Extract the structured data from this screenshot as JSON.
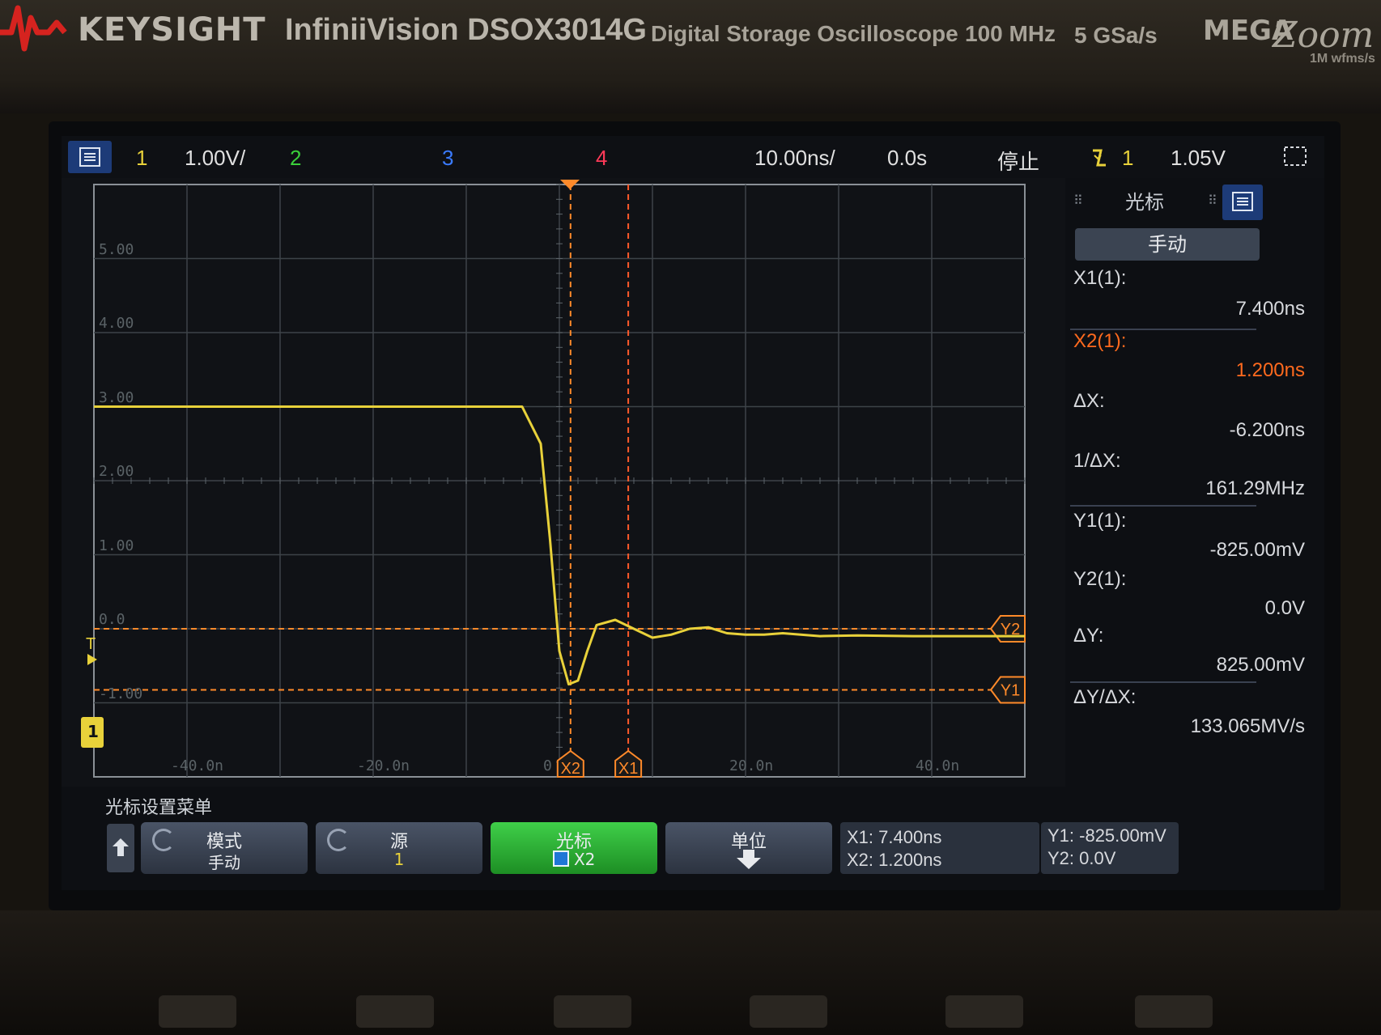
{
  "header": {
    "brand": "KEYSIGHT",
    "model": "InfiniiVision DSOX3014G",
    "description": "Digital Storage Oscilloscope",
    "bandwidth": "100 MHz",
    "sample_rate": "5 GSa/s",
    "badge_mega": "MEGA",
    "badge_zoom": "Zoom",
    "badge_wfms": "1M wfms/s"
  },
  "status_bar": {
    "menu_icon": "menu-icon",
    "ch1_label": "1",
    "ch1_scale": "1.00V/",
    "ch2_label": "2",
    "ch3_label": "3",
    "ch4_label": "4",
    "time_scale": "10.00ns/",
    "delay": "0.0s",
    "run_state": "停止",
    "trigger_icon": "trigger-falling-edge-icon",
    "trigger_source": "1",
    "trigger_level": "1.05V",
    "colors": {
      "ch1": "#e8d13a",
      "ch2": "#3ad03a",
      "ch3": "#3a7bff",
      "ch4": "#ff3a58",
      "cursor": "#ff8a2a"
    }
  },
  "graticule": {
    "y_labels": [
      "5.00",
      "4.00",
      "3.00",
      "2.00",
      "1.00",
      "0.0",
      "-1.00"
    ],
    "x_labels": [
      "-40.0n",
      "-20.0n",
      "0",
      "20.0n",
      "40.0n"
    ],
    "trigger_marker": "T",
    "ground_marker": "1"
  },
  "chart_data": {
    "type": "line",
    "title": "",
    "xlabel": "",
    "ylabel": "",
    "x_unit": "ns",
    "y_unit": "V",
    "xlim": [
      -50,
      50
    ],
    "ylim": [
      -2,
      6
    ],
    "grid": true,
    "series": [
      {
        "x": [
          -50,
          -4,
          -2,
          -1,
          0,
          1,
          2,
          3,
          4,
          6,
          8,
          10,
          12,
          14,
          16,
          18,
          20,
          22,
          24,
          28,
          32,
          38,
          50
        ],
        "y": [
          3.0,
          3.0,
          2.5,
          1.2,
          -0.3,
          -0.75,
          -0.7,
          -0.3,
          0.05,
          0.12,
          0.0,
          -0.12,
          -0.08,
          0.0,
          0.02,
          -0.06,
          -0.08,
          -0.08,
          -0.06,
          -0.1,
          -0.09,
          -0.1,
          -0.1
        ]
      }
    ],
    "cursors": {
      "X1_ns": 7.4,
      "X2_ns": 1.2,
      "Y1_V": -0.825,
      "Y2_V": 0.0
    },
    "markers": {
      "trigger_level_V": 1.05,
      "ground_V": 0.0,
      "trigger_time_ns": 0
    }
  },
  "cursor_tags": {
    "x1": "X1",
    "x2": "X2",
    "y1": "Y1",
    "y2": "Y2"
  },
  "panel": {
    "title": "光标",
    "panel_icon": "menu-icon",
    "mode": "手动",
    "x1_label": "X1(1):",
    "x1_value": "7.400ns",
    "x2_label": "X2(1):",
    "x2_value": "1.200ns",
    "dx_label": "ΔX:",
    "dx_value": "-6.200ns",
    "inv_dx_label": "1/ΔX:",
    "inv_dx_value": "161.29MHz",
    "y1_label": "Y1(1):",
    "y1_value": "-825.00mV",
    "y2_label": "Y2(1):",
    "y2_value": "0.0V",
    "dy_label": "ΔY:",
    "dy_value": "825.00mV",
    "dydx_label": "ΔY/ΔX:",
    "dydx_value": "133.065MV/s"
  },
  "softkeys": {
    "menu_title": "光标设置菜单",
    "mode_top": "模式",
    "mode_bottom": "手动",
    "source_top": "源",
    "source_bottom": "1",
    "cursor_top": "光标",
    "cursor_bottom": "X2",
    "units_top": "单位",
    "readout_x1": "X1: 7.400ns",
    "readout_x2": "X2: 1.200ns",
    "readout_y1": "Y1: -825.00mV",
    "readout_y2": "Y2: 0.0V"
  }
}
